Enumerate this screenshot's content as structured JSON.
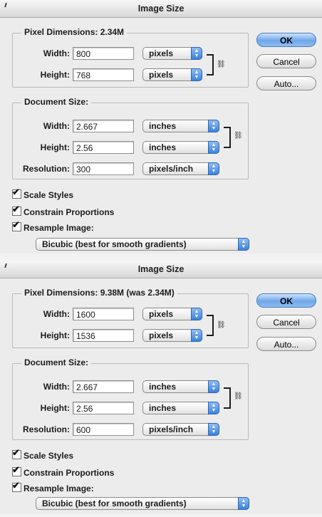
{
  "dialogs": [
    {
      "title": "Image Size",
      "pixel_dimensions": {
        "legend": "Pixel Dimensions:  2.34M",
        "width_label": "Width:",
        "width_value": "800",
        "width_unit": "pixels",
        "height_label": "Height:",
        "height_value": "768",
        "height_unit": "pixels"
      },
      "document_size": {
        "legend": "Document Size:",
        "width_label": "Width:",
        "width_value": "2.667",
        "width_unit": "inches",
        "height_label": "Height:",
        "height_value": "2.56",
        "height_unit": "inches",
        "resolution_label": "Resolution:",
        "resolution_value": "300",
        "resolution_unit": "pixels/inch"
      },
      "buttons": {
        "ok": "OK",
        "cancel": "Cancel",
        "auto": "Auto..."
      },
      "checkboxes": {
        "scale_styles": "Scale Styles",
        "constrain": "Constrain Proportions",
        "resample": "Resample Image:"
      },
      "resample_method": "Bicubic (best for smooth gradients)"
    },
    {
      "title": "Image Size",
      "pixel_dimensions": {
        "legend": "Pixel Dimensions:  9.38M (was 2.34M)",
        "width_label": "Width:",
        "width_value": "1600",
        "width_unit": "pixels",
        "height_label": "Height:",
        "height_value": "1536",
        "height_unit": "pixels"
      },
      "document_size": {
        "legend": "Document Size:",
        "width_label": "Width:",
        "width_value": "2.667",
        "width_unit": "inches",
        "height_label": "Height:",
        "height_value": "2.56",
        "height_unit": "inches",
        "resolution_label": "Resolution:",
        "resolution_value": "600",
        "resolution_unit": "pixels/inch"
      },
      "buttons": {
        "ok": "OK",
        "cancel": "Cancel",
        "auto": "Auto..."
      },
      "checkboxes": {
        "scale_styles": "Scale Styles",
        "constrain": "Constrain Proportions",
        "resample": "Resample Image:"
      },
      "resample_method": "Bicubic (best for smooth gradients)"
    }
  ],
  "colors": {
    "accent_blue": "#3a82dc",
    "dialog_bg": "#ececec"
  },
  "icons": {
    "link": "chain-link-icon",
    "stepper": "up-down-arrows-icon",
    "check": "checkmark-icon"
  }
}
